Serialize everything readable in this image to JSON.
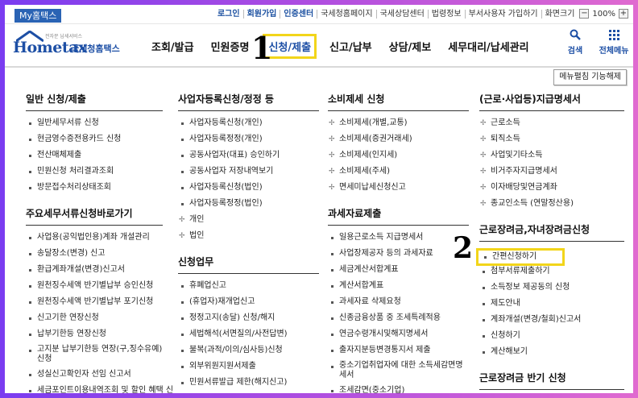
{
  "util": {
    "my_tab": "My홈택스",
    "links": [
      "로그인",
      "회원가입",
      "인증센터",
      "국세청홈페이지",
      "국세상담센터",
      "법령정보",
      "부서사용자 가입하기",
      "화면크기"
    ],
    "zoom_minus": "−",
    "zoom_value": "100%",
    "zoom_plus": "+"
  },
  "logo": {
    "main": "Hometax",
    "sub": "국세청홈택스",
    "tag": "전자문 납세서비스"
  },
  "nav": [
    "조회/발급",
    "민원증명",
    "신청/제출",
    "신고/납부",
    "상담/제보",
    "세무대리/납세관리"
  ],
  "annotations": {
    "n1": "1",
    "n2": "2"
  },
  "tools": {
    "search": "검색",
    "all_menu": "전체메뉴"
  },
  "mega": {
    "close": "메뉴펼침 기능해제",
    "col1": [
      {
        "title": "일반 신청/제출",
        "items": [
          "일반세무서류 신청",
          "현금영수증전용카드 신청",
          "전산매체제출",
          "민원신청 처리결과조회",
          "방문접수처리상태조회"
        ]
      },
      {
        "title": "주요세무서류신청바로가기",
        "items": [
          "사업용(공익법인용)계좌 개설관리",
          "송달장소(변경) 신고",
          "환급계좌개설(변경)신고서",
          "원천징수세액 반기별납부 승인신청",
          "원천징수세액 반기별납부 포기신청",
          "신고기한 연장신청",
          "납부기한등 연장신청",
          "고지분 납부기한등 연장(구,징수유예)신청",
          "성실신고확인자 선임 신고서",
          "세금포인트이용내역조회 및 할인 혜택 신"
        ]
      }
    ],
    "col2": [
      {
        "title": "사업자등록신청/정정 등",
        "items": [
          "사업자등록신청(개인)",
          "사업자등록정정(개인)",
          "공동사업자(대표) 승인하기",
          "공동사업자 저장내역보기",
          "사업자등록신청(법인)",
          "사업자등록정정(법인)"
        ],
        "plus": [
          "개인",
          "법인"
        ]
      },
      {
        "title": "신청업무",
        "items": [
          "휴폐업신고",
          "(휴업자)재개업신고",
          "정정고지(송달) 신청/해지",
          "세법해석(서면질의/사전답변)",
          "불복(과적/이의/심사등)신청",
          "외부위원지원서제출",
          "민원서류발급 제한(해지신고)"
        ]
      }
    ],
    "col3": [
      {
        "title": "소비제세 신청",
        "plus": [
          "소비제세(개별,교통)",
          "소비제세(증권거래세)",
          "소비제세(인지세)",
          "소비제세(주세)",
          "면세미납세신청신고"
        ]
      },
      {
        "title": "과세자료제출",
        "items": [
          "일용근로소득 지급명세서",
          "사업장제공자 등의 과세자료",
          "세금계산서합계표",
          "계산서합계표",
          "과세자료 삭제요청",
          "신종금융상품 중 조세특례적용",
          "연금수령개시및해지명세서",
          "출자지분등변경통지서 제출",
          "중소기업취업자에 대한 소득세감면명세서",
          "조세감면(중소기업)"
        ]
      }
    ],
    "col4": [
      {
        "title": "(근로·사업등)지급명세서",
        "plus": [
          "근로소득",
          "퇴직소득",
          "사업및기타소득",
          "비거주자지급명세서",
          "이자배당및연금계좌",
          "종교인소득 (연말정산용)"
        ]
      },
      {
        "title": "근로장려금,자녀장려금신청",
        "items": [
          "간편신청하기",
          "첨부서류제출하기",
          "소득정보 제공동의 신청",
          "제도안내",
          "계좌개설(변경/철회)신고서",
          "신청하기",
          "계산해보기"
        ]
      },
      {
        "title": "근로장려금 반기 신청",
        "items": []
      }
    ]
  }
}
